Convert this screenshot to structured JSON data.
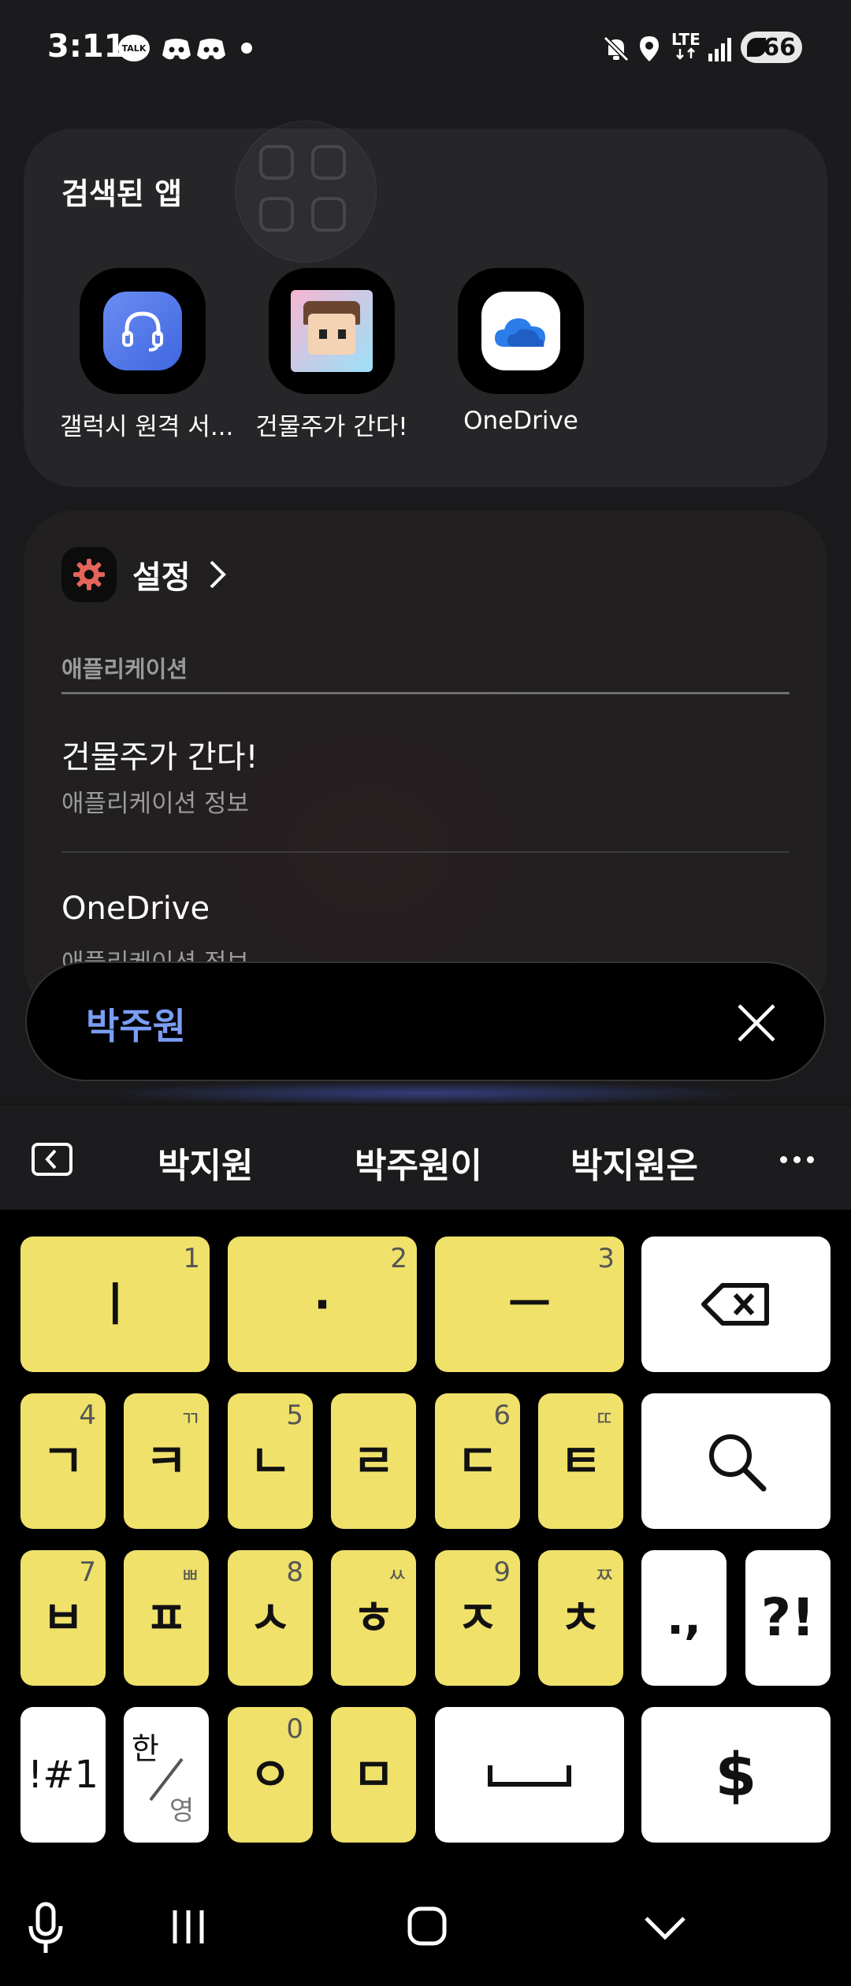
{
  "status_bar": {
    "time": "3:11",
    "talk_badge": "TALK",
    "lte_label": "LTE",
    "battery": "66"
  },
  "apps_card": {
    "title": "검색된 앱",
    "apps": [
      {
        "label": "갤럭시 원격 서...",
        "icon": "headset-icon"
      },
      {
        "label": "건물주가 간다!",
        "icon": "game-icon"
      },
      {
        "label": "OneDrive",
        "icon": "cloud-icon"
      }
    ]
  },
  "settings_card": {
    "title": "설정",
    "section": "애플리케이션",
    "rows": [
      {
        "title": "건물주가 간다!",
        "subtitle": "애플리케이션 정보"
      },
      {
        "title": "OneDrive",
        "subtitle": "애플리케이션 정보"
      }
    ]
  },
  "search": {
    "query": "박주원"
  },
  "suggestions": [
    "박지원",
    "박주원이",
    "박지원은"
  ],
  "keyboard": {
    "row1": [
      {
        "main": "ㅣ",
        "sub": "1"
      },
      {
        "main": "·",
        "sub": "2"
      },
      {
        "main": "ㅡ",
        "sub": "3"
      }
    ],
    "row2": [
      {
        "main": "ㄱ",
        "sub": "4"
      },
      {
        "main": "ㅋ",
        "sub": "ㄲ"
      },
      {
        "main": "ㄴ",
        "sub": "5"
      },
      {
        "main": "ㄹ",
        "sub": ""
      },
      {
        "main": "ㄷ",
        "sub": "6"
      },
      {
        "main": "ㅌ",
        "sub": "ㄸ"
      }
    ],
    "row3": [
      {
        "main": "ㅂ",
        "sub": "7"
      },
      {
        "main": "ㅍ",
        "sub": "ㅃ"
      },
      {
        "main": "ㅅ",
        "sub": "8"
      },
      {
        "main": "ㅎ",
        "sub": "ㅆ"
      },
      {
        "main": "ㅈ",
        "sub": "9"
      },
      {
        "main": "ㅊ",
        "sub": "ㅉ"
      }
    ],
    "punct1": ".,",
    "punct2": "?!",
    "symbols": "!#1",
    "lang_top": "한",
    "lang_bottom": "영",
    "row4": [
      {
        "main": "ㅇ",
        "sub": "0"
      },
      {
        "main": "ㅁ",
        "sub": ""
      }
    ],
    "currency": "$"
  }
}
